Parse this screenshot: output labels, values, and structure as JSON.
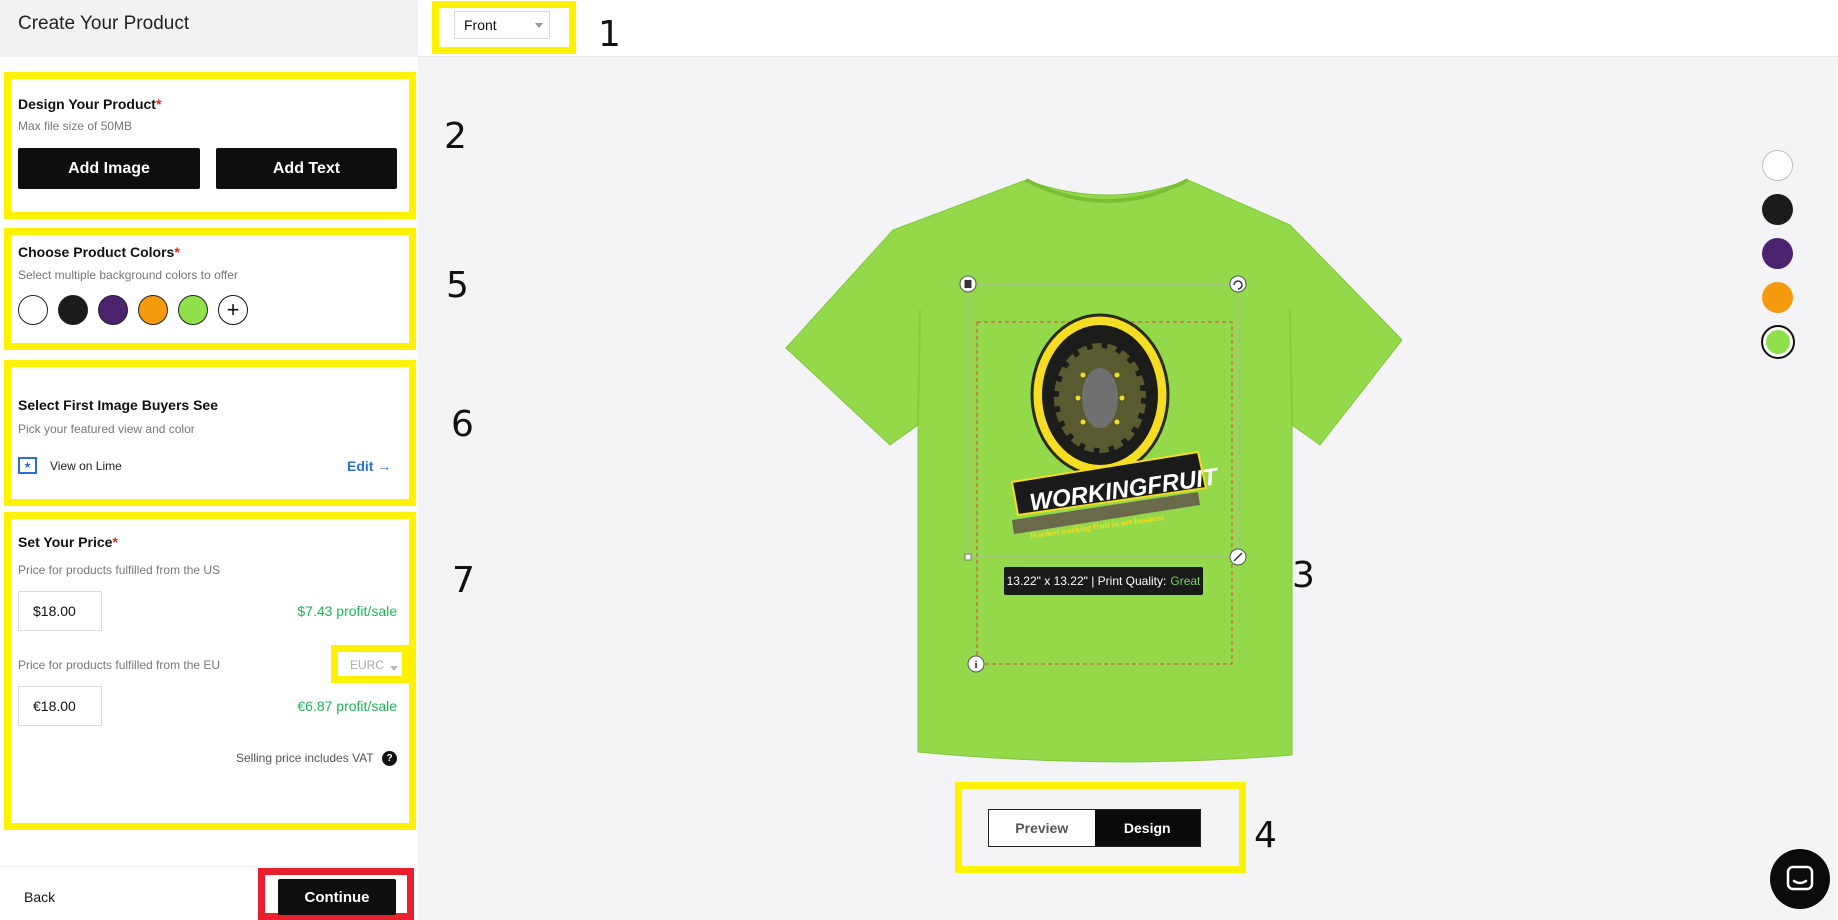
{
  "header": {
    "title": "Create Your Product"
  },
  "design": {
    "title": "Design Your Product",
    "required": "*",
    "subtitle": "Max file size of 50MB",
    "add_image": "Add Image",
    "add_text": "Add Text"
  },
  "colors": {
    "title": "Choose Product Colors",
    "required": "*",
    "subtitle": "Select multiple background colors to offer",
    "swatches": [
      "#ffffff",
      "#1b1b1b",
      "#4a226e",
      "#f59a0c",
      "#8fe04a"
    ],
    "add_symbol": "+"
  },
  "featured": {
    "title": "Select First Image Buyers See",
    "subtitle": "Pick your featured view and color",
    "view_label": "View on Lime",
    "edit_label": "Edit →"
  },
  "price": {
    "title": "Set Your Price",
    "required": "*",
    "us_label": "Price for products fulfilled from the US",
    "us_price": "$18.00",
    "us_profit": "$7.43 profit/sale",
    "eu_label": "Price for products fulfilled from the EU",
    "currency": "EURC",
    "eu_price": "€18.00",
    "eu_profit": "€6.87 profit/sale",
    "vat_note": "Selling price includes VAT",
    "help": "?"
  },
  "footer": {
    "back": "Back",
    "continue": "Continue"
  },
  "toolbar": {
    "view_select": "Front"
  },
  "annotations": [
    "1",
    "2",
    "3",
    "4",
    "5",
    "6",
    "7"
  ],
  "canvas": {
    "shirt_color": "#93d94a",
    "print_size": "13.22\" x 13.22\" | Print Quality:",
    "print_quality": "Great",
    "logo_text": "WORKINGFRUIT",
    "logo_tagline": "Hardest working fruit in net business"
  },
  "right_swatches": [
    "#ffffff",
    "#1b1b1b",
    "#4a226e",
    "#f59a0c",
    "#8fe04a"
  ],
  "view_toggle": {
    "preview": "Preview",
    "design": "Design"
  }
}
